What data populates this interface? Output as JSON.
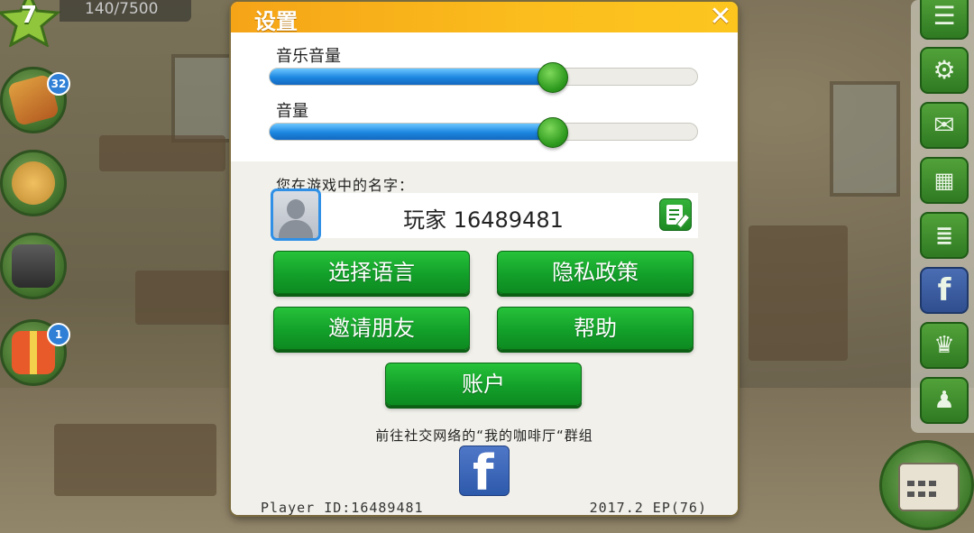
{
  "hud": {
    "level": "7",
    "xp": "140/7500",
    "recipe_badge": "32",
    "gift_badge": "1"
  },
  "right_menu": {
    "icons": [
      "list-icon",
      "gears-icon",
      "mail-icon",
      "calendar-icon",
      "notes-icon",
      "facebook-icon",
      "trophy-icon",
      "waiter-icon"
    ]
  },
  "dialog": {
    "title": "设置",
    "music_volume_label": "音乐音量",
    "music_volume": 0.66,
    "sound_volume_label": "音量",
    "sound_volume": 0.66,
    "name_label": "您在游戏中的名字：",
    "player_name": "玩家 16489481",
    "buttons": {
      "language": "选择语言",
      "privacy": "隐私政策",
      "invite": "邀请朋友",
      "help": "帮助",
      "account": "账户"
    },
    "social_text": "前往社交网络的“我的咖啡厅“群组",
    "player_id": "Player ID:16489481",
    "version": "2017.2 EP(76)"
  },
  "colors": {
    "title_bar": "#fbbd1d",
    "button_green": "#13a02a",
    "slider_blue": "#1d86e0",
    "facebook_blue": "#2e5aab"
  }
}
